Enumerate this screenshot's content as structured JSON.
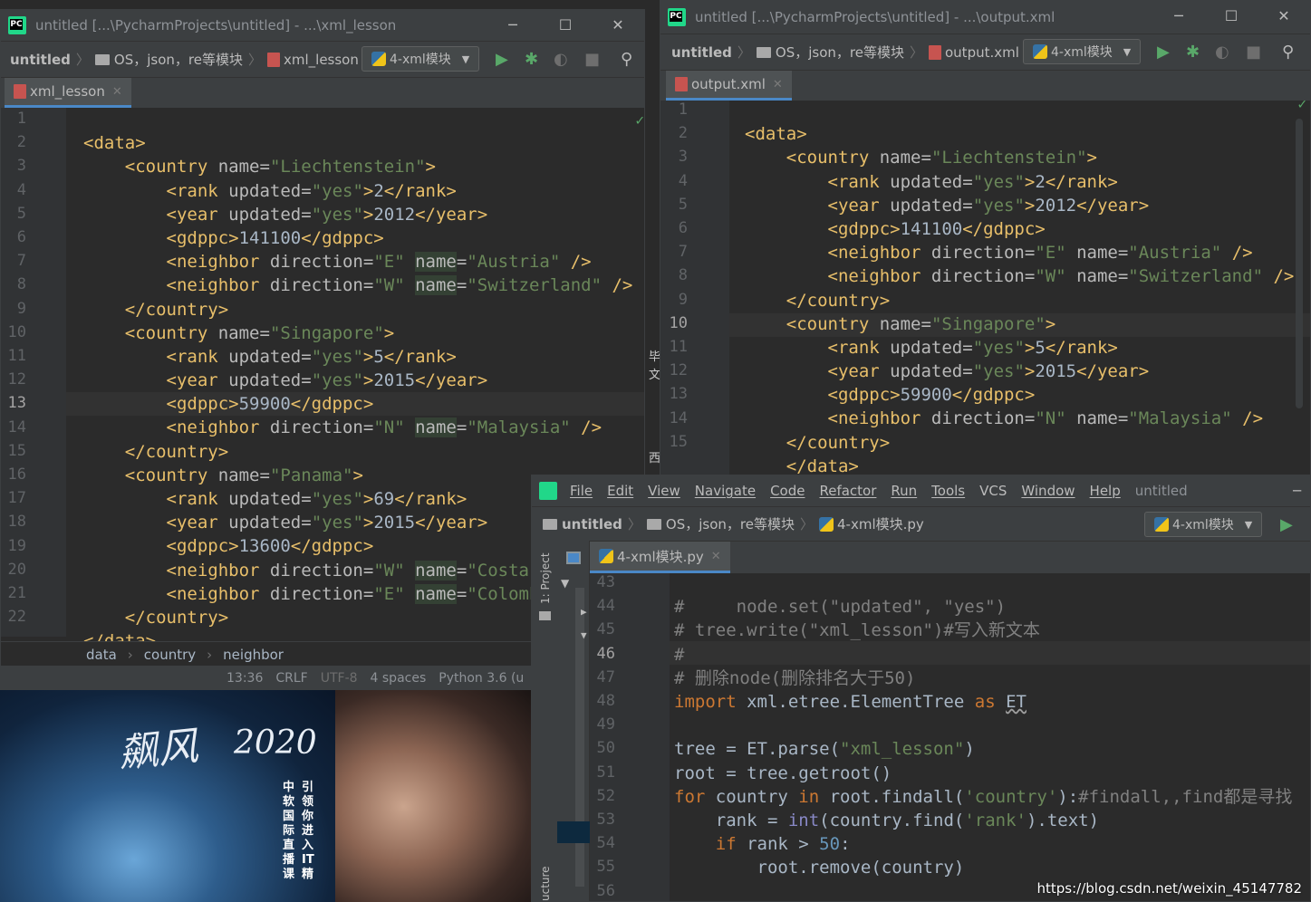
{
  "win1": {
    "title": "untitled [...\\PycharmProjects\\untitled] - ...\\xml_lesson",
    "nav": {
      "project": "untitled",
      "folder": "OS，json，re等模块",
      "file": "xml_lesson"
    },
    "runcfg": "4-xml模块",
    "tab": "xml_lesson",
    "lines": [
      "1",
      "2",
      "3",
      "4",
      "5",
      "6",
      "7",
      "8",
      "9",
      "10",
      "11",
      "12",
      "13",
      "14",
      "15",
      "16",
      "17",
      "18",
      "19",
      "20",
      "21",
      "22"
    ],
    "current_line": "13",
    "breadcrumb": [
      "data",
      "country",
      "neighbor"
    ],
    "status": {
      "pos": "13:36",
      "le": "CRLF",
      "enc": "UTF-8",
      "indent": "4 spaces",
      "interp": "Python 3.6 (u"
    }
  },
  "win2": {
    "title": "untitled [...\\PycharmProjects\\untitled] - ...\\output.xml",
    "nav": {
      "project": "untitled",
      "folder": "OS，json，re等模块",
      "file": "output.xml"
    },
    "runcfg": "4-xml模块",
    "tab": "output.xml",
    "lines": [
      "1",
      "2",
      "3",
      "4",
      "5",
      "6",
      "7",
      "8",
      "9",
      "10",
      "11",
      "12",
      "13",
      "14",
      "15"
    ],
    "current_line": "10"
  },
  "win3": {
    "menu": [
      "File",
      "Edit",
      "View",
      "Navigate",
      "Code",
      "Refactor",
      "Run",
      "Tools",
      "VCS",
      "Window",
      "Help"
    ],
    "project_name": "untitled",
    "nav": {
      "project": "untitled",
      "folder": "OS，json，re等模块",
      "file": "4-xml模块.py"
    },
    "runcfg": "4-xml模块",
    "tab": "4-xml模块.py",
    "sidebar_project": "1: Project",
    "sidebar_structure": "ucture",
    "lines": [
      "43",
      "44",
      "45",
      "46",
      "47",
      "48",
      "49",
      "50",
      "51",
      "52",
      "53",
      "54",
      "55",
      "56"
    ],
    "current_line": "46"
  },
  "desktop": {
    "brand": "飙风",
    "year": "2020",
    "v1": "中软国际直播课",
    "v2": "引领你进入IT精",
    "side_chars": [
      "毕",
      "文",
      "西"
    ]
  },
  "watermark": "https://blog.csdn.net/weixin_45147782"
}
